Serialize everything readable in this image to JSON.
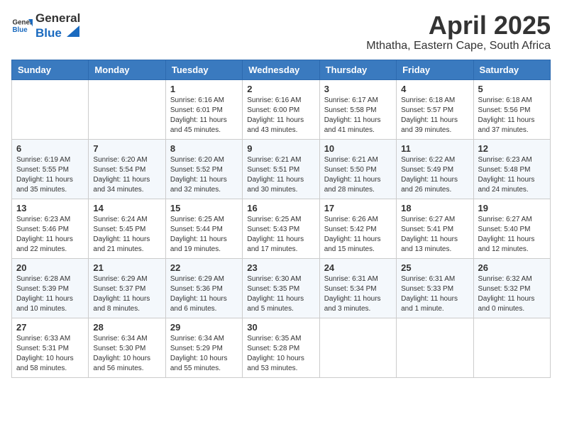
{
  "header": {
    "logo_general": "General",
    "logo_blue": "Blue",
    "title": "April 2025",
    "subtitle": "Mthatha, Eastern Cape, South Africa"
  },
  "days_of_week": [
    "Sunday",
    "Monday",
    "Tuesday",
    "Wednesday",
    "Thursday",
    "Friday",
    "Saturday"
  ],
  "weeks": [
    [
      {
        "day": "",
        "text": ""
      },
      {
        "day": "",
        "text": ""
      },
      {
        "day": "1",
        "text": "Sunrise: 6:16 AM\nSunset: 6:01 PM\nDaylight: 11 hours and 45 minutes."
      },
      {
        "day": "2",
        "text": "Sunrise: 6:16 AM\nSunset: 6:00 PM\nDaylight: 11 hours and 43 minutes."
      },
      {
        "day": "3",
        "text": "Sunrise: 6:17 AM\nSunset: 5:58 PM\nDaylight: 11 hours and 41 minutes."
      },
      {
        "day": "4",
        "text": "Sunrise: 6:18 AM\nSunset: 5:57 PM\nDaylight: 11 hours and 39 minutes."
      },
      {
        "day": "5",
        "text": "Sunrise: 6:18 AM\nSunset: 5:56 PM\nDaylight: 11 hours and 37 minutes."
      }
    ],
    [
      {
        "day": "6",
        "text": "Sunrise: 6:19 AM\nSunset: 5:55 PM\nDaylight: 11 hours and 35 minutes."
      },
      {
        "day": "7",
        "text": "Sunrise: 6:20 AM\nSunset: 5:54 PM\nDaylight: 11 hours and 34 minutes."
      },
      {
        "day": "8",
        "text": "Sunrise: 6:20 AM\nSunset: 5:52 PM\nDaylight: 11 hours and 32 minutes."
      },
      {
        "day": "9",
        "text": "Sunrise: 6:21 AM\nSunset: 5:51 PM\nDaylight: 11 hours and 30 minutes."
      },
      {
        "day": "10",
        "text": "Sunrise: 6:21 AM\nSunset: 5:50 PM\nDaylight: 11 hours and 28 minutes."
      },
      {
        "day": "11",
        "text": "Sunrise: 6:22 AM\nSunset: 5:49 PM\nDaylight: 11 hours and 26 minutes."
      },
      {
        "day": "12",
        "text": "Sunrise: 6:23 AM\nSunset: 5:48 PM\nDaylight: 11 hours and 24 minutes."
      }
    ],
    [
      {
        "day": "13",
        "text": "Sunrise: 6:23 AM\nSunset: 5:46 PM\nDaylight: 11 hours and 22 minutes."
      },
      {
        "day": "14",
        "text": "Sunrise: 6:24 AM\nSunset: 5:45 PM\nDaylight: 11 hours and 21 minutes."
      },
      {
        "day": "15",
        "text": "Sunrise: 6:25 AM\nSunset: 5:44 PM\nDaylight: 11 hours and 19 minutes."
      },
      {
        "day": "16",
        "text": "Sunrise: 6:25 AM\nSunset: 5:43 PM\nDaylight: 11 hours and 17 minutes."
      },
      {
        "day": "17",
        "text": "Sunrise: 6:26 AM\nSunset: 5:42 PM\nDaylight: 11 hours and 15 minutes."
      },
      {
        "day": "18",
        "text": "Sunrise: 6:27 AM\nSunset: 5:41 PM\nDaylight: 11 hours and 13 minutes."
      },
      {
        "day": "19",
        "text": "Sunrise: 6:27 AM\nSunset: 5:40 PM\nDaylight: 11 hours and 12 minutes."
      }
    ],
    [
      {
        "day": "20",
        "text": "Sunrise: 6:28 AM\nSunset: 5:39 PM\nDaylight: 11 hours and 10 minutes."
      },
      {
        "day": "21",
        "text": "Sunrise: 6:29 AM\nSunset: 5:37 PM\nDaylight: 11 hours and 8 minutes."
      },
      {
        "day": "22",
        "text": "Sunrise: 6:29 AM\nSunset: 5:36 PM\nDaylight: 11 hours and 6 minutes."
      },
      {
        "day": "23",
        "text": "Sunrise: 6:30 AM\nSunset: 5:35 PM\nDaylight: 11 hours and 5 minutes."
      },
      {
        "day": "24",
        "text": "Sunrise: 6:31 AM\nSunset: 5:34 PM\nDaylight: 11 hours and 3 minutes."
      },
      {
        "day": "25",
        "text": "Sunrise: 6:31 AM\nSunset: 5:33 PM\nDaylight: 11 hours and 1 minute."
      },
      {
        "day": "26",
        "text": "Sunrise: 6:32 AM\nSunset: 5:32 PM\nDaylight: 11 hours and 0 minutes."
      }
    ],
    [
      {
        "day": "27",
        "text": "Sunrise: 6:33 AM\nSunset: 5:31 PM\nDaylight: 10 hours and 58 minutes."
      },
      {
        "day": "28",
        "text": "Sunrise: 6:34 AM\nSunset: 5:30 PM\nDaylight: 10 hours and 56 minutes."
      },
      {
        "day": "29",
        "text": "Sunrise: 6:34 AM\nSunset: 5:29 PM\nDaylight: 10 hours and 55 minutes."
      },
      {
        "day": "30",
        "text": "Sunrise: 6:35 AM\nSunset: 5:28 PM\nDaylight: 10 hours and 53 minutes."
      },
      {
        "day": "",
        "text": ""
      },
      {
        "day": "",
        "text": ""
      },
      {
        "day": "",
        "text": ""
      }
    ]
  ]
}
